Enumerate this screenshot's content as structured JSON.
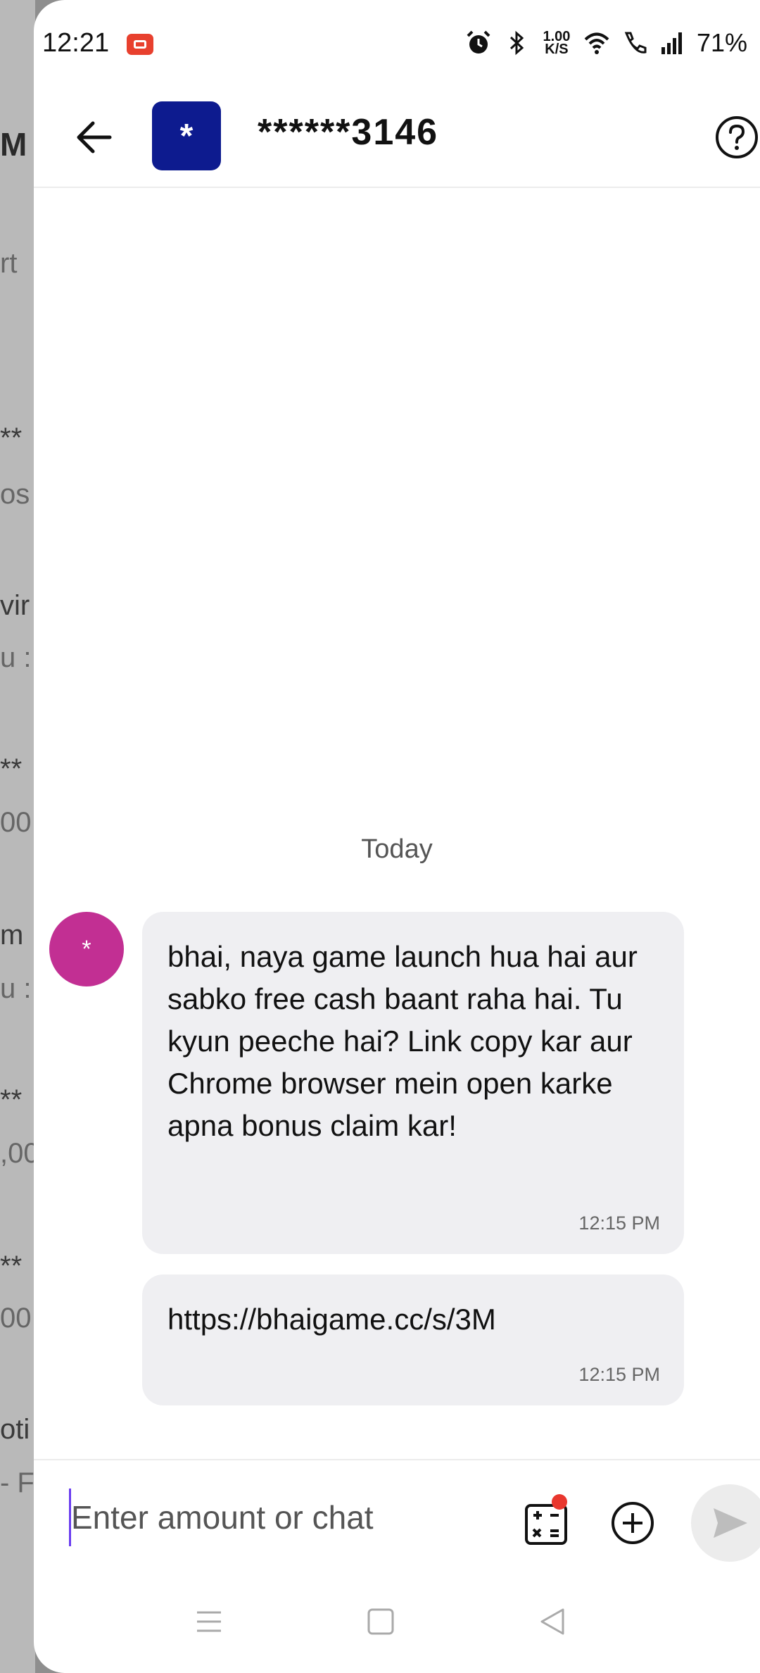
{
  "status_bar": {
    "time": "12:21",
    "net_speed_top": "1.00",
    "net_speed_bottom": "K/S",
    "battery": "71%"
  },
  "header": {
    "avatar_symbol": "*",
    "contact": "******3146",
    "back_icon": "arrow-left-icon",
    "help_icon": "question-circle-icon"
  },
  "chat": {
    "date_label": "Today",
    "sender_avatar_symbol": "*",
    "messages": [
      {
        "text": "bhai, naya game launch hua hai aur sabko free cash baant raha hai. Tu kyun peeche hai? Link copy kar aur Chrome browser mein open karke apna bonus claim kar!",
        "time": "12:15 PM"
      },
      {
        "text": "https://bhaigame.cc/s/3M",
        "time": "12:15 PM"
      }
    ]
  },
  "input": {
    "placeholder": "Enter amount or chat",
    "value": ""
  },
  "background_list": {
    "fragments": [
      "M",
      "rt",
      "**",
      "os",
      "vir",
      "u :",
      "**",
      "00",
      "m",
      "u :",
      "**",
      ",00",
      "**",
      "00",
      "oti",
      "- F"
    ]
  },
  "colors": {
    "avatar": "#0d1b8f",
    "sender_avatar": "#c22f93",
    "bubble": "#efeff2",
    "badge": "#e9372e"
  }
}
